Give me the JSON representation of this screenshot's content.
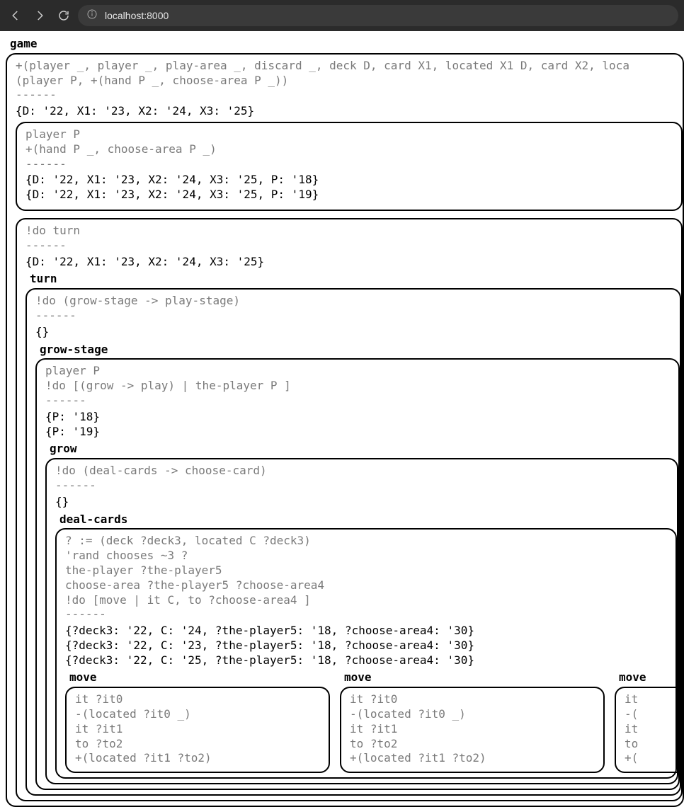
{
  "browser": {
    "url": "localhost:8000"
  },
  "tree": {
    "title": "game",
    "body": "+(player _, player _, play-area _, discard _, deck D, card X1, located X1 D, card X2, loca\n(player P, +(hand P _, choose-area P _))\n------",
    "state": "{D: '22, X1: '23, X2: '24, X3: '25}",
    "children": [
      {
        "type": "box",
        "body": "player P\n+(hand P _, choose-area P _)\n------",
        "state": "{D: '22, X1: '23, X2: '24, X3: '25, P: '18}\n{D: '22, X1: '23, X2: '24, X3: '25, P: '19}"
      },
      {
        "type": "box",
        "body": "!do turn\n------",
        "state": "{D: '22, X1: '23, X2: '24, X3: '25}",
        "children": [
          {
            "type": "rule",
            "title": "turn",
            "body": "!do (grow-stage -> play-stage)\n------",
            "state": "{}",
            "children": [
              {
                "type": "rule",
                "title": "grow-stage",
                "body": "player P\n!do [(grow -> play) | the-player P ]\n------",
                "state": "{P: '18}\n{P: '19}",
                "children": [
                  {
                    "type": "rule",
                    "title": "grow",
                    "body": "!do (deal-cards -> choose-card)\n------",
                    "state": "{}",
                    "children": [
                      {
                        "type": "rule",
                        "title": "deal-cards",
                        "body": "? := (deck ?deck3, located C ?deck3)\n'rand chooses ~3 ?\nthe-player ?the-player5\nchoose-area ?the-player5 ?choose-area4\n!do [move | it C, to ?choose-area4 ]\n------",
                        "state": "{?deck3: '22, C: '24, ?the-player5: '18, ?choose-area4: '30}\n{?deck3: '22, C: '23, ?the-player5: '18, ?choose-area4: '30}\n{?deck3: '22, C: '25, ?the-player5: '18, ?choose-area4: '30}",
                        "moves": [
                          {
                            "title": "move",
                            "body": "it ?it0\n-(located ?it0 _)\nit ?it1\nto ?to2\n+(located ?it1 ?to2)"
                          },
                          {
                            "title": "move",
                            "body": "it ?it0\n-(located ?it0 _)\nit ?it1\nto ?to2\n+(located ?it1 ?to2)"
                          },
                          {
                            "title": "move",
                            "body": "it\n-(\nit\nto\n+("
                          }
                        ]
                      }
                    ]
                  }
                ]
              }
            ]
          }
        ]
      }
    ]
  }
}
